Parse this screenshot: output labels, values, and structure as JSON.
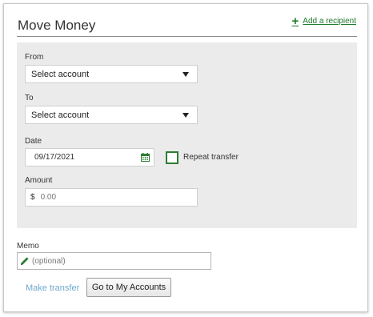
{
  "header": {
    "title": "Move Money",
    "add_recipient_label": "Add a recipient",
    "add_icon": "plus-icon"
  },
  "form": {
    "from": {
      "label": "From",
      "selected_value": "Select account"
    },
    "to": {
      "label": "To",
      "selected_value": "Select account"
    },
    "date": {
      "label": "Date",
      "value": "09/17/2021",
      "icon": "calendar-icon"
    },
    "repeat": {
      "label": "Repeat transfer",
      "checked": false
    },
    "amount": {
      "label": "Amount",
      "currency_symbol": "$",
      "placeholder": "0.00"
    }
  },
  "memo": {
    "label": "Memo",
    "placeholder": "(optional)",
    "icon": "pencil-icon"
  },
  "actions": {
    "make_transfer_label": "Make transfer",
    "go_to_accounts_label": "Go to My Accounts"
  },
  "colors": {
    "accent_green": "#1c7a2a",
    "link_blue_disabled": "#6fa9cc",
    "panel_background": "#ebebeb"
  }
}
